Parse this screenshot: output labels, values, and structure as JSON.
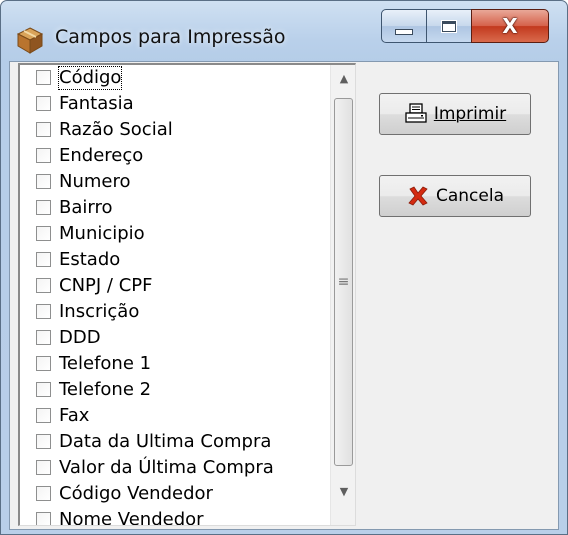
{
  "window": {
    "title": "Campos para Impressão",
    "close_glyph": "X",
    "icon": "package-icon"
  },
  "fields": [
    {
      "label": "Código",
      "checked": false
    },
    {
      "label": "Fantasia",
      "checked": false
    },
    {
      "label": "Razão Social",
      "checked": false
    },
    {
      "label": "Endereço",
      "checked": false
    },
    {
      "label": "Numero",
      "checked": false
    },
    {
      "label": "Bairro",
      "checked": false
    },
    {
      "label": "Municipio",
      "checked": false
    },
    {
      "label": "Estado",
      "checked": false
    },
    {
      "label": "CNPJ / CPF",
      "checked": false
    },
    {
      "label": "Inscrição",
      "checked": false
    },
    {
      "label": "DDD",
      "checked": false
    },
    {
      "label": "Telefone 1",
      "checked": false
    },
    {
      "label": "Telefone 2",
      "checked": false
    },
    {
      "label": "Fax",
      "checked": false
    },
    {
      "label": "Data da Ultima Compra",
      "checked": false
    },
    {
      "label": "Valor da Última Compra",
      "checked": false
    },
    {
      "label": "Código Vendedor",
      "checked": false
    },
    {
      "label": "Nome Vendedor",
      "checked": false
    }
  ],
  "buttons": {
    "print_label": "Imprimir",
    "print_icon": "printer-icon",
    "cancel_label": "Cancela",
    "cancel_icon": "red-x-icon"
  },
  "scrollbar": {
    "up_glyph": "▲",
    "down_glyph": "▼",
    "grip_glyph": "≡"
  },
  "colors": {
    "title_bar": "#b9d0ea",
    "close_button": "#c2391e",
    "cancel_x": "#d42a10"
  }
}
